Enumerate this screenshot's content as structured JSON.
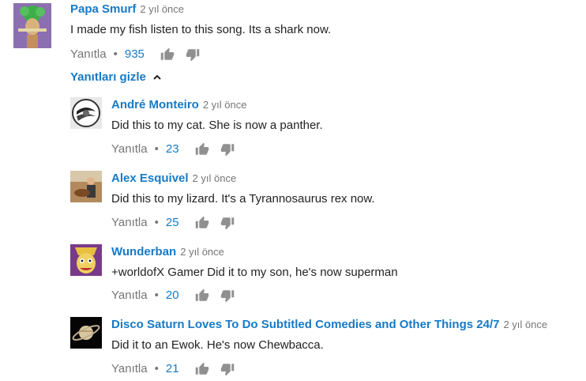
{
  "top_comment": {
    "author": "Papa Smurf",
    "time": "2 yıl önce",
    "text": "I made my fish listen to this song. Its a shark now.",
    "reply_label": "Yanıtla",
    "likes": "935"
  },
  "hide_replies_label": "Yanıtları gizle",
  "replies": [
    {
      "author": "André Monteiro",
      "time": "2 yıl önce",
      "text": "Did this to my cat. She is now a panther.",
      "reply_label": "Yanıtla",
      "likes": "23"
    },
    {
      "author": "Alex Esquivel",
      "time": "2 yıl önce",
      "text": "Did this to my lizard. It's a Tyrannosaurus rex now.",
      "reply_label": "Yanıtla",
      "likes": "25"
    },
    {
      "author": "Wunderban",
      "time": "2 yıl önce",
      "text": "+worldofX Gamer Did it to my son, he's now superman",
      "reply_label": "Yanıtla",
      "likes": "20"
    },
    {
      "author": "Disco Saturn Loves To Do Subtitled Comedies and Other Things 24/7",
      "time": "2 yıl önce",
      "text": "Did it to an Ewok. He's now Chewbacca.",
      "reply_label": "Yanıtla",
      "likes": "21"
    }
  ],
  "colors": {
    "link": "#167ac6",
    "muted": "#767676",
    "text": "#222222",
    "icon": "#909090"
  },
  "icons": {
    "like": "thumbs-up-icon",
    "dislike": "thumbs-down-icon",
    "collapse": "chevron-up-icon"
  }
}
